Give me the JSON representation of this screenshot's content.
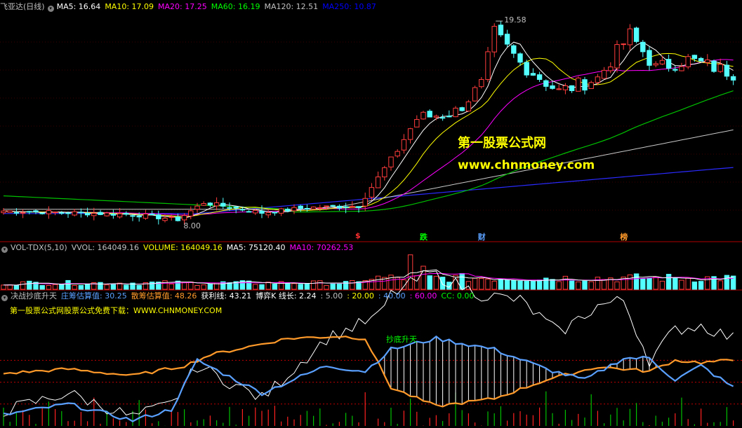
{
  "main_header": {
    "title": "飞亚达(日线)",
    "items": [
      {
        "label": "MA5: 16.64",
        "color": "#ffffff"
      },
      {
        "label": "MA10: 17.09",
        "color": "#ffff00"
      },
      {
        "label": "MA20: 17.25",
        "color": "#ff00ff"
      },
      {
        "label": "MA60: 16.19",
        "color": "#00ff00"
      },
      {
        "label": "MA120: 12.51",
        "color": "#c0c0c0"
      },
      {
        "label": "MA250: 10.87",
        "color": "#0000ff"
      }
    ]
  },
  "vol_header": {
    "title": "VOL-TDX(5,10)",
    "items": [
      {
        "label": "VVOL: 164049.16",
        "color": "#c0c0c0"
      },
      {
        "label": "VOLUME: 164049.16",
        "color": "#ffff00"
      },
      {
        "label": "MA5: 75120.40",
        "color": "#ffffff"
      },
      {
        "label": "MA10: 70262.53",
        "color": "#ff00ff"
      }
    ]
  },
  "ind_header": {
    "title": "决战抄底升天",
    "items": [
      {
        "label": "庄筹估算值: 30.25",
        "color": "#5aa0ff"
      },
      {
        "label": "散筹估算值: 48.26",
        "color": "#ff9a2a"
      },
      {
        "label": "获利线: 43.21",
        "color": "#ffffff"
      },
      {
        "label": "博弈K 线长: 2.24",
        "color": "#ffffff"
      },
      {
        "label": ": 5.00",
        "color": "#c0c0c0"
      },
      {
        "label": ": 20.00",
        "color": "#ffff00"
      },
      {
        "label": ": 40.00",
        "color": "#5aa0ff"
      },
      {
        "label": ": 60.00",
        "color": "#ff00ff"
      },
      {
        "label": "CC: 0.00",
        "color": "#00ff00"
      }
    ],
    "subtitle": "第一股票公式网股票公式免费下载：WWW.CHNMONEY.COM"
  },
  "watermark": {
    "line1": "第一股票公式网",
    "line2": "www.chnmoney.com"
  },
  "signals": [
    {
      "text": "$",
      "color": "#ff3030",
      "index": 55
    },
    {
      "text": "跌",
      "color": "#00ff00",
      "index": 65
    },
    {
      "text": "财",
      "color": "#5aa0ff",
      "index": 74
    },
    {
      "text": "榜",
      "color": "#ff9a2a",
      "index": 96
    }
  ],
  "annotations": {
    "signal_label": "抄底升天",
    "high_label": "19.58",
    "low_label": "8.00"
  },
  "colors": {
    "up": "#ff3c3c",
    "down": "#54ffff",
    "bg": "#000000",
    "divider": "#b00000"
  },
  "chart_data": {
    "type": "candlestick",
    "count": 114,
    "ylim": [
      7.5,
      20.5
    ],
    "key_points": [
      {
        "i": 0,
        "c": 8.7
      },
      {
        "i": 20,
        "c": 8.5
      },
      {
        "i": 27,
        "c": 8.2
      },
      {
        "i": 31,
        "c": 9.2
      },
      {
        "i": 40,
        "c": 8.6
      },
      {
        "i": 47,
        "c": 8.9
      },
      {
        "i": 55,
        "c": 9.0
      },
      {
        "i": 60,
        "c": 11.8
      },
      {
        "i": 64,
        "c": 14.2
      },
      {
        "i": 70,
        "c": 14.6
      },
      {
        "i": 74,
        "c": 16.2
      },
      {
        "i": 76,
        "c": 19.3
      },
      {
        "i": 80,
        "c": 17.5
      },
      {
        "i": 86,
        "c": 15.8
      },
      {
        "i": 92,
        "c": 16.6
      },
      {
        "i": 97,
        "c": 19.2
      },
      {
        "i": 101,
        "c": 17.2
      },
      {
        "i": 106,
        "c": 17.7
      },
      {
        "i": 113,
        "c": 16.9
      }
    ],
    "vol_peaks": [
      {
        "i": 63,
        "v": 164049
      },
      {
        "i": 65,
        "v": 110000
      }
    ],
    "vol_base": 30000,
    "vol_ylim": [
      0,
      170000
    ],
    "ind_ylim": [
      0,
      100
    ],
    "ind_key_points": {
      "zhuang": [
        [
          0,
          10
        ],
        [
          10,
          20
        ],
        [
          20,
          5
        ],
        [
          26,
          15
        ],
        [
          30,
          60
        ],
        [
          40,
          30
        ],
        [
          50,
          55
        ],
        [
          56,
          50
        ],
        [
          60,
          70
        ],
        [
          67,
          80
        ],
        [
          76,
          70
        ],
        [
          84,
          52
        ],
        [
          90,
          42
        ],
        [
          96,
          62
        ],
        [
          100,
          62
        ],
        [
          104,
          42
        ],
        [
          108,
          55
        ],
        [
          113,
          35
        ]
      ],
      "san": [
        [
          0,
          48
        ],
        [
          10,
          52
        ],
        [
          20,
          46
        ],
        [
          28,
          55
        ],
        [
          32,
          65
        ],
        [
          44,
          80
        ],
        [
          52,
          82
        ],
        [
          56,
          80
        ],
        [
          60,
          35
        ],
        [
          67,
          18
        ],
        [
          76,
          25
        ],
        [
          84,
          42
        ],
        [
          92,
          54
        ],
        [
          100,
          50
        ],
        [
          104,
          60
        ],
        [
          108,
          58
        ],
        [
          113,
          60
        ]
      ],
      "huoli": [
        [
          0,
          14
        ],
        [
          10,
          30
        ],
        [
          20,
          8
        ],
        [
          26,
          20
        ],
        [
          30,
          55
        ],
        [
          40,
          25
        ],
        [
          50,
          80
        ],
        [
          58,
          100
        ],
        [
          60,
          120
        ],
        [
          66,
          140
        ],
        [
          74,
          120
        ],
        [
          80,
          115
        ],
        [
          86,
          85
        ],
        [
          92,
          110
        ],
        [
          96,
          115
        ],
        [
          100,
          60
        ],
        [
          104,
          88
        ],
        [
          108,
          92
        ],
        [
          113,
          80
        ]
      ]
    }
  }
}
